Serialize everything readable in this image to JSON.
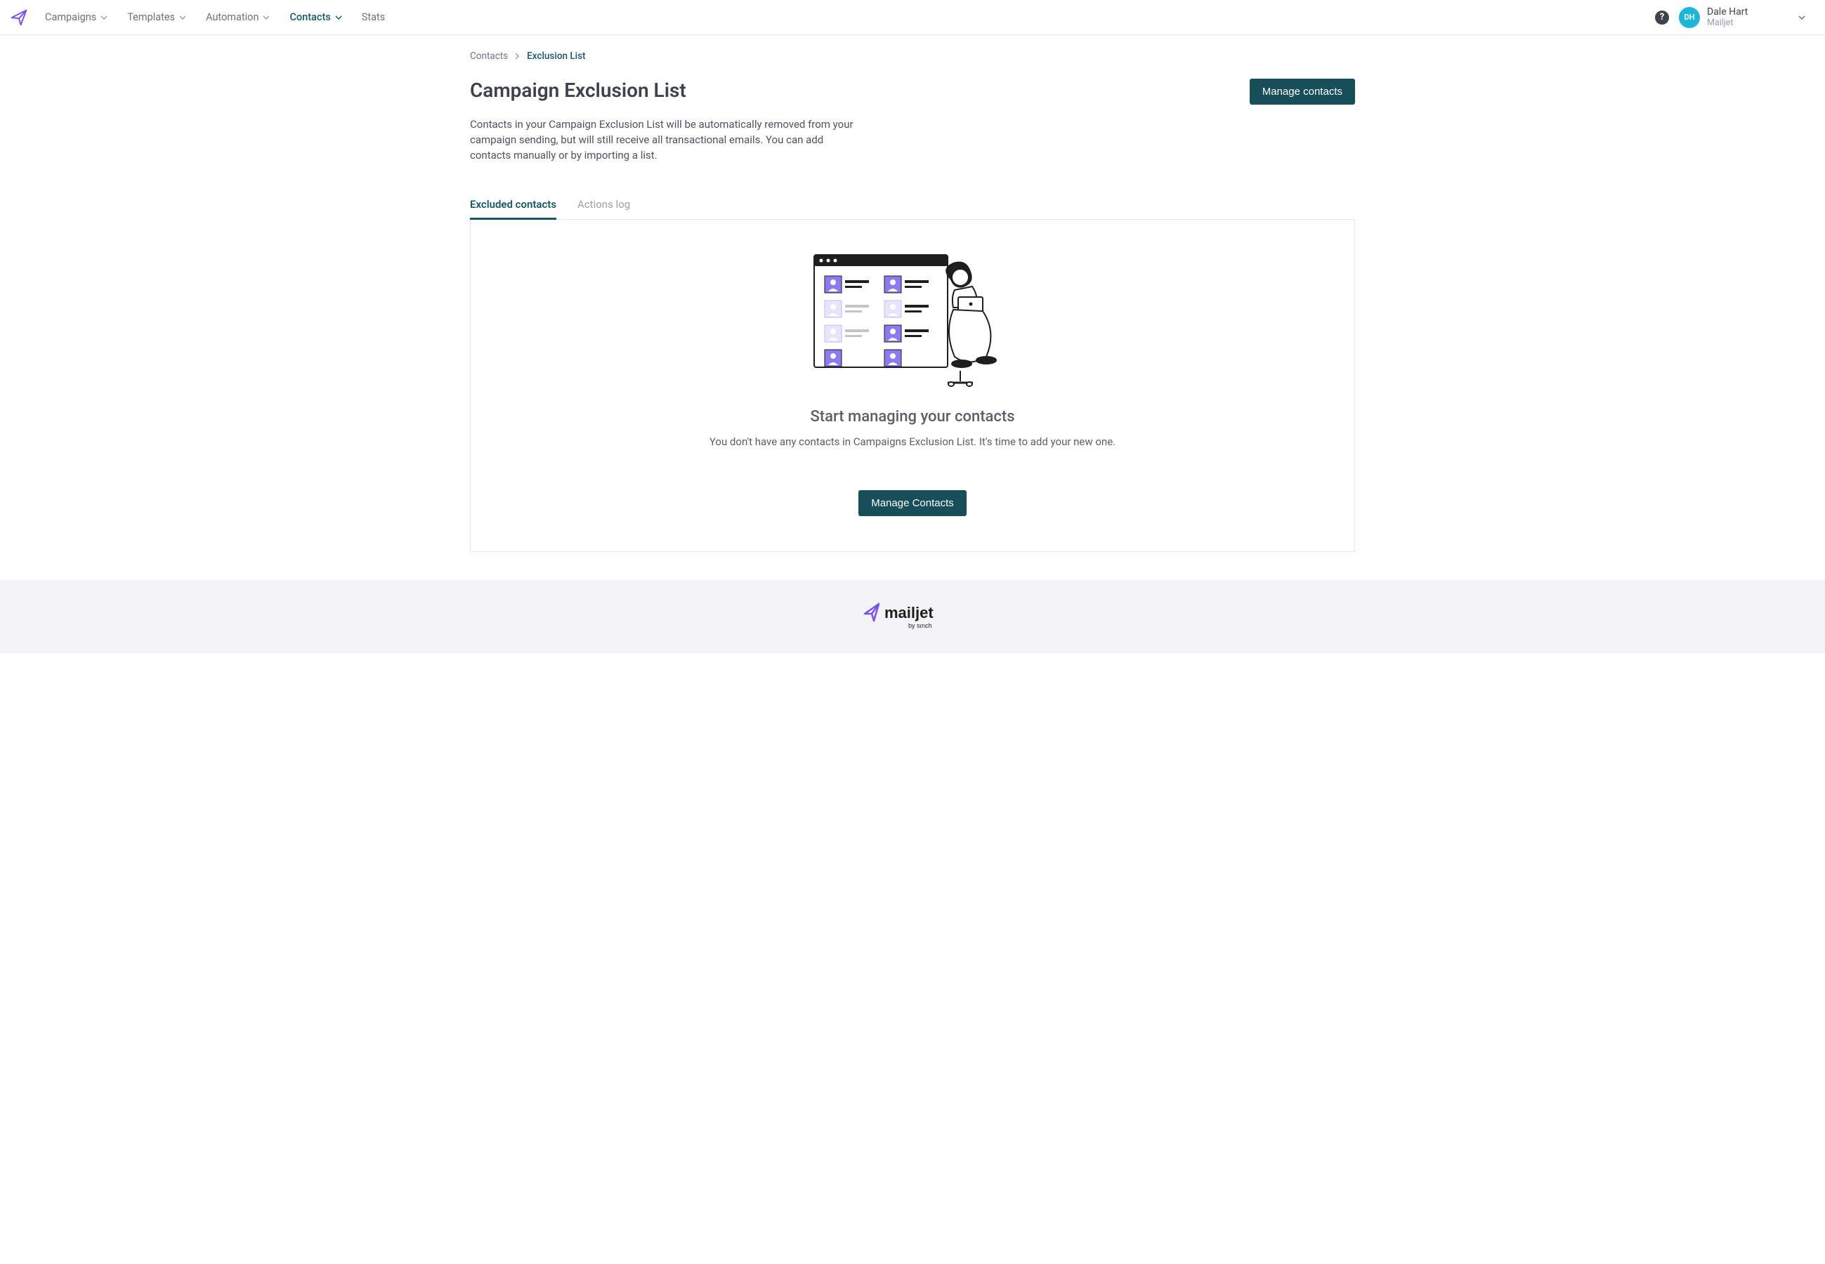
{
  "nav": {
    "items": [
      {
        "label": "Campaigns",
        "has_dropdown": true,
        "active": false
      },
      {
        "label": "Templates",
        "has_dropdown": true,
        "active": false
      },
      {
        "label": "Automation",
        "has_dropdown": true,
        "active": false
      },
      {
        "label": "Contacts",
        "has_dropdown": true,
        "active": true
      },
      {
        "label": "Stats",
        "has_dropdown": false,
        "active": false
      }
    ]
  },
  "user": {
    "initials": "DH",
    "name": "Dale Hart",
    "org": "Mailjet"
  },
  "breadcrumb": {
    "parent": "Contacts",
    "current": "Exclusion List"
  },
  "page": {
    "title": "Campaign Exclusion List",
    "manage_button": "Manage contacts",
    "description": "Contacts in your Campaign Exclusion List will be automatically removed from your campaign sending, but will still receive all transactional emails. You can add contacts manually or by importing a list."
  },
  "tabs": [
    {
      "label": "Excluded contacts",
      "active": true
    },
    {
      "label": "Actions log",
      "active": false
    }
  ],
  "empty_state": {
    "title": "Start managing your contacts",
    "subtitle": "You don't have any contacts in Campaigns Exclusion List. It's time to add your new one.",
    "button": "Manage Contacts"
  },
  "footer": {
    "brand": "mailjet",
    "byline": "by sinch"
  },
  "help_glyph": "?"
}
